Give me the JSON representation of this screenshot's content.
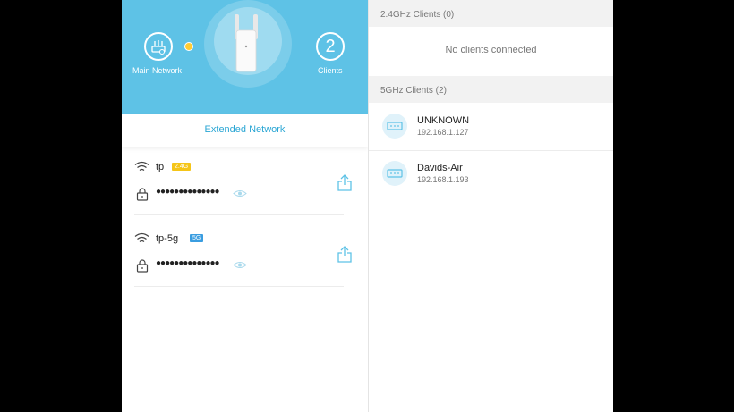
{
  "topology": {
    "main_network_label": "Main Network",
    "clients_label": "Clients",
    "clients_count": "2",
    "extended_network_label": "Extended Network"
  },
  "networks": [
    {
      "ssid": "tp",
      "band": "2.4G",
      "password_mask": "●●●●●●●●●●●●●●",
      "band_color": "#f5c518"
    },
    {
      "ssid": "tp-5g",
      "band": "5G",
      "password_mask": "●●●●●●●●●●●●●●",
      "band_color": "#3a9de0"
    }
  ],
  "clients_panel": {
    "band24_header": "2.4GHz Clients (0)",
    "band24_empty": "No clients connected",
    "band5_header": "5GHz Clients (2)",
    "band5_clients": [
      {
        "name": "UNKNOWN",
        "ip": "192.168.1.127"
      },
      {
        "name": "Davids-Air",
        "ip": "192.168.1.193"
      }
    ]
  },
  "colors": {
    "accent": "#5ec2e6",
    "link": "#2aa6d4"
  }
}
